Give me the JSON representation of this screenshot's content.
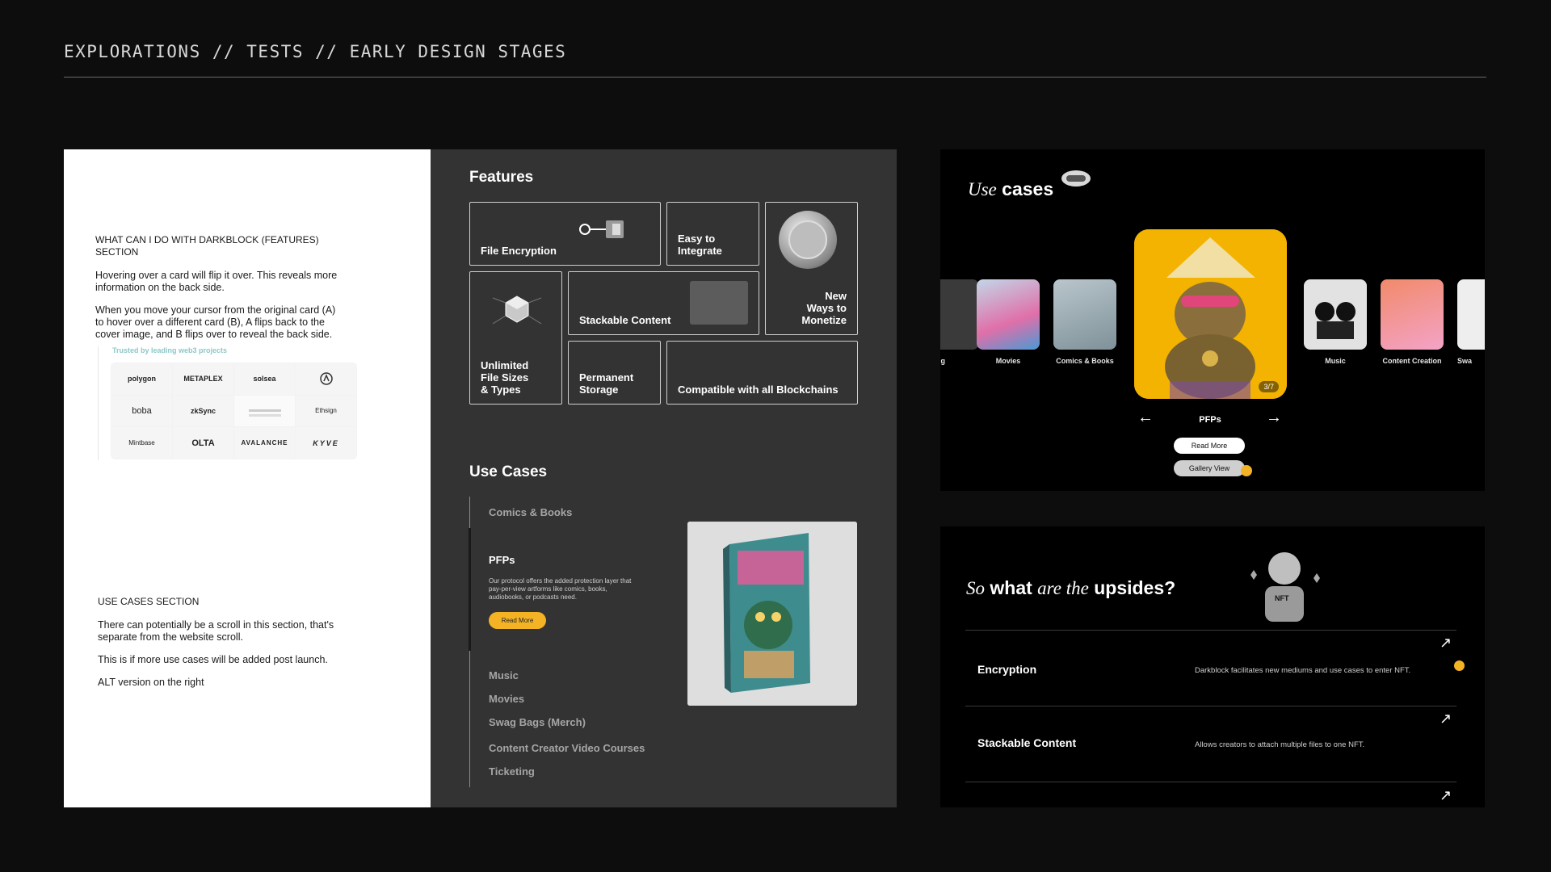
{
  "header": {
    "title": "EXPLORATIONS // TESTS // EARLY DESIGN STAGES"
  },
  "notes": {
    "features_section": {
      "heading": "WHAT CAN I DO WITH DARKBLOCK (features) SECTION",
      "p1": "Hovering over a card will flip it over. This reveals more information on the back side.",
      "p2": "When you move your cursor from the original card (A) to hover over a different card (B), A flips back to the cover image, and B flips over to reveal the back side."
    },
    "trusted": {
      "title": "Trusted by leading web3 projects",
      "logos": [
        "polygon",
        "METAPLEX",
        "solsea",
        "",
        "boba",
        "zkSync",
        "",
        "Ethsign",
        "Mintbase",
        "OLTA",
        "AVALANCHE",
        "KYVE"
      ]
    },
    "use_cases_section": {
      "heading": "USE CASES SECTION",
      "p1": "There can potentially be a scroll in this section, that's separate from the website scroll.",
      "p2": "This is if more use cases will be added post launch.",
      "p3": "ALT version on the right"
    }
  },
  "features": {
    "title": "Features",
    "cards": {
      "file_encryption": "File Encryption",
      "easy_integrate": "Easy to Integrate",
      "new_ways": "New Ways to Monetize",
      "unlimited": "Unlimited File Sizes & Types",
      "stackable": "Stackable Content",
      "permanent": "Permanent Storage",
      "compatible": "Compatible with all Blockchains"
    }
  },
  "use_cases": {
    "title": "Use Cases",
    "items_top": [
      "Comics & Books"
    ],
    "active": {
      "title": "PFPs",
      "description": "Our protocol offers the added protection layer that pay-per-view artforms like comics, books, audiobooks, or podcasts need.",
      "button": "Read More"
    },
    "items_bottom": [
      "Music",
      "Movies",
      "Swag Bags (Merch)",
      "Content Creator Video Courses",
      "Ticketing"
    ]
  },
  "carousel": {
    "title_italic": "Use",
    "title_bold": "cases",
    "thumbs": [
      {
        "label": "ing",
        "color": "#3a3a3a"
      },
      {
        "label": "Movies",
        "color": "#c2d7e8"
      },
      {
        "label": "Comics & Books",
        "color": "#9ba9b0"
      },
      {
        "label": "Music",
        "color": "#dcdcdc"
      },
      {
        "label": "Content Creation",
        "color": "#f4a3c8"
      },
      {
        "label": "Swa",
        "color": "#eeeeee"
      }
    ],
    "pager": "3/7",
    "current": "PFPs",
    "prev_arrow": "←",
    "next_arrow": "→",
    "read_more": "Read More",
    "gallery_view": "Gallery View"
  },
  "upsides": {
    "title_italic_1": "So",
    "title_bold_1": "what",
    "title_italic_2": "are the",
    "title_bold_2": "upsides?",
    "rows": [
      {
        "title": "Encryption",
        "desc": "Darkblock facilitates new mediums and use cases to enter NFT."
      },
      {
        "title": "Stackable Content",
        "desc": "Allows creators to attach multiple files to one NFT."
      }
    ],
    "arrow": "↗",
    "badge": "NFT"
  },
  "colors": {
    "accent": "#f4b324",
    "panel": "#333334",
    "background": "#0d0d0d"
  }
}
